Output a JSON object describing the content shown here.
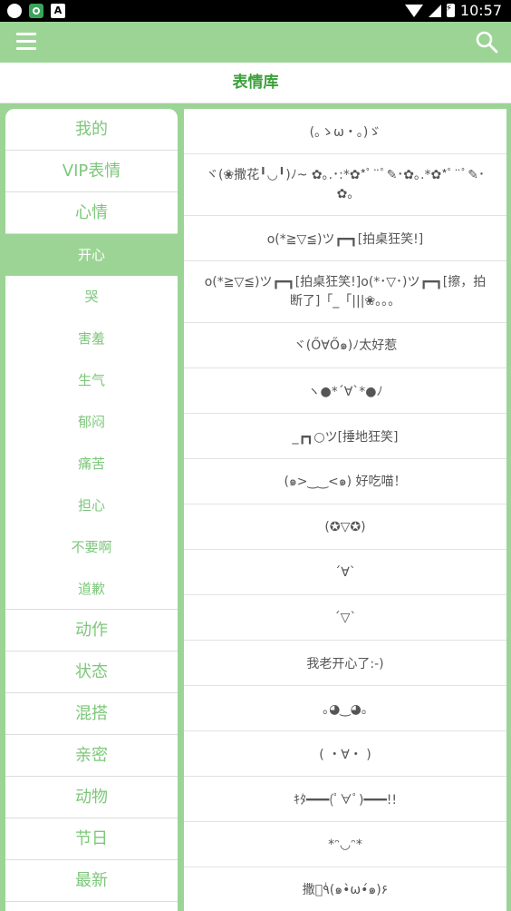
{
  "status_bar": {
    "time": "10:57"
  },
  "header": {
    "menu_icon": "hamburger-menu-icon",
    "search_icon": "search-icon",
    "bg_color": "#9cd495"
  },
  "title": "表情库",
  "colors": {
    "accent": "#9cd495",
    "title": "#3aa13a",
    "sidebar_text": "#7cc77a"
  },
  "sidebar": {
    "top_items": [
      "我的",
      "VIP表情",
      "心情"
    ],
    "sub_items": [
      "开心",
      "哭",
      "害羞",
      "生气",
      "郁闷",
      "痛苦",
      "担心",
      "不要啊",
      "道歉"
    ],
    "active_sub_index": 0,
    "bottom_items": [
      "动作",
      "状态",
      "混搭",
      "亲密",
      "动物",
      "节日",
      "最新"
    ]
  },
  "emoticons": [
    "(｡ゝω・｡)ゞ",
    "ヾ(❀撒花╹◡╹)ﾉ~ ✿｡.･:*✿*ﾟ¨ﾟ✎･✿｡.*✿*ﾟ¨ﾟ✎･✿｡",
    "o(*≧▽≦)ツ┏━┓[拍桌狂笑!]",
    "o(*≧▽≦)ツ┏━┓[拍桌狂笑!]o(*･▽･)ツ┏━┓[擦，拍断了]「_「|||❀。。。",
    "ヾ(Ő∀Ő๑)ﾉ太好惹",
    "ヽ●*´∀`*●ﾉ",
    "_┏┓○ツ[捶地狂笑]",
    "(๑>‿‿<๑) 好吃喵！",
    "(✪▽✪)",
    "´∀`",
    "´▽`",
    "我老开心了:-)",
    "｡◕‿◕｡",
    "( ・∀・ )",
    "ｷﾀ━━━(ﾟ∀ﾟ)━━━!!",
    "*ᵔ◡ᵔ*",
    "撒花ٰ٩(๑•̀ω•́๑)۶"
  ]
}
